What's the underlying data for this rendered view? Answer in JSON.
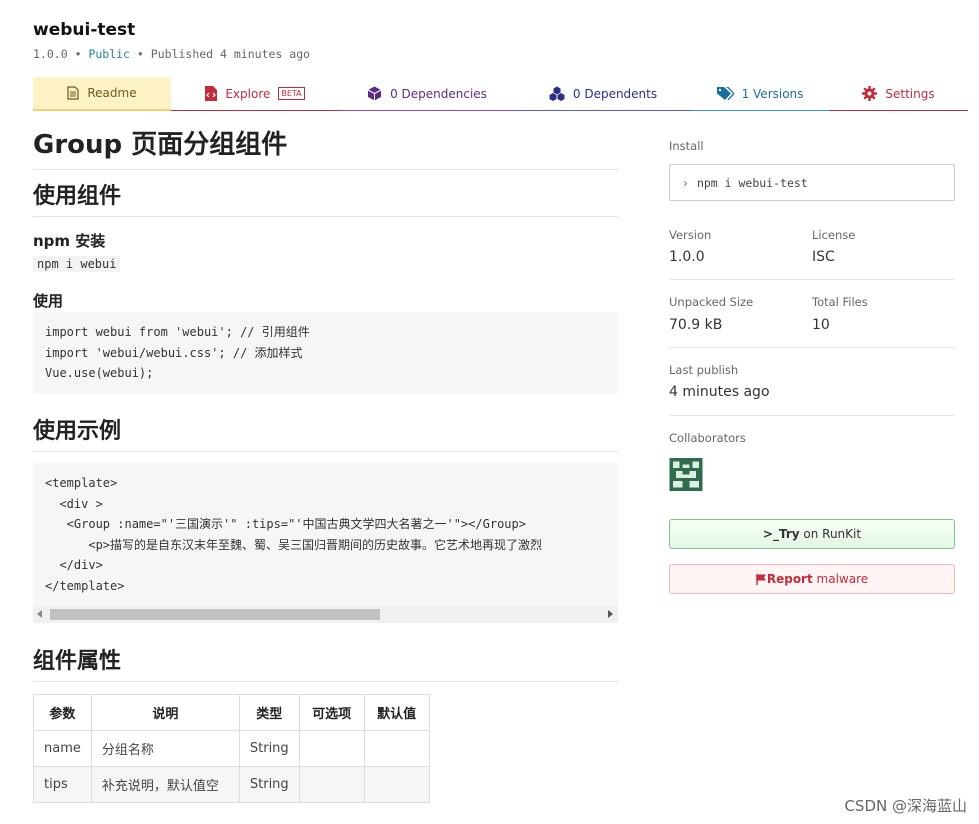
{
  "package": {
    "name": "webui-test",
    "version": "1.0.0",
    "visibility": "Public",
    "published": "Published 4 minutes ago",
    "separator": "•"
  },
  "tabs": {
    "readme": "Readme",
    "explore": "Explore",
    "explore_badge": "BETA",
    "dependencies": "0 Dependencies",
    "dependents": "0 Dependents",
    "versions": "1 Versions",
    "settings": "Settings"
  },
  "readme": {
    "title": "Group 页面分组组件",
    "section_use": "使用组件",
    "npm_install_heading": "npm 安装",
    "npm_install_cmd": "npm i webui",
    "usage_heading": "使用",
    "usage_code": "import webui from 'webui'; // 引用组件\nimport 'webui/webui.css'; // 添加样式\nVue.use(webui);",
    "section_example": "使用示例",
    "example_code": "<template>\n  <div >\n   <Group :name=\"'三国演示'\" :tips=\"'中国古典文学四大名著之一'\"></Group>\n      <p>描写的是自东汉末年至魏、蜀、吴三国归晋期间的历史故事。它艺术地再现了激烈\n  </div>\n</template>",
    "section_props": "组件属性",
    "props_table": {
      "headers": [
        "参数",
        "说明",
        "类型",
        "可选项",
        "默认值"
      ],
      "rows": [
        [
          "name",
          "分组名称",
          "String",
          "",
          ""
        ],
        [
          "tips",
          "补充说明，默认值空",
          "String",
          "",
          ""
        ]
      ]
    }
  },
  "sidebar": {
    "install_label": "Install",
    "install_cmd": "npm i webui-test",
    "version_label": "Version",
    "version_value": "1.0.0",
    "license_label": "License",
    "license_value": "ISC",
    "unpacked_label": "Unpacked Size",
    "unpacked_value": "70.9 kB",
    "files_label": "Total Files",
    "files_value": "10",
    "last_publish_label": "Last publish",
    "last_publish_value": "4 minutes ago",
    "collaborators_label": "Collaborators",
    "runkit_prefix": ">_",
    "runkit_try": "Try",
    "runkit_rest": " on RunKit",
    "report_strong": "Report",
    "report_rest": " malware"
  },
  "watermark": "CSDN @深海蓝山",
  "colors": {
    "readme_tab_bg": "#fdf2c5",
    "accent_red": "#c22b3b",
    "accent_purple": "#5a2b86",
    "accent_blue": "#1b6fa0",
    "public_teal": "#22828f"
  }
}
